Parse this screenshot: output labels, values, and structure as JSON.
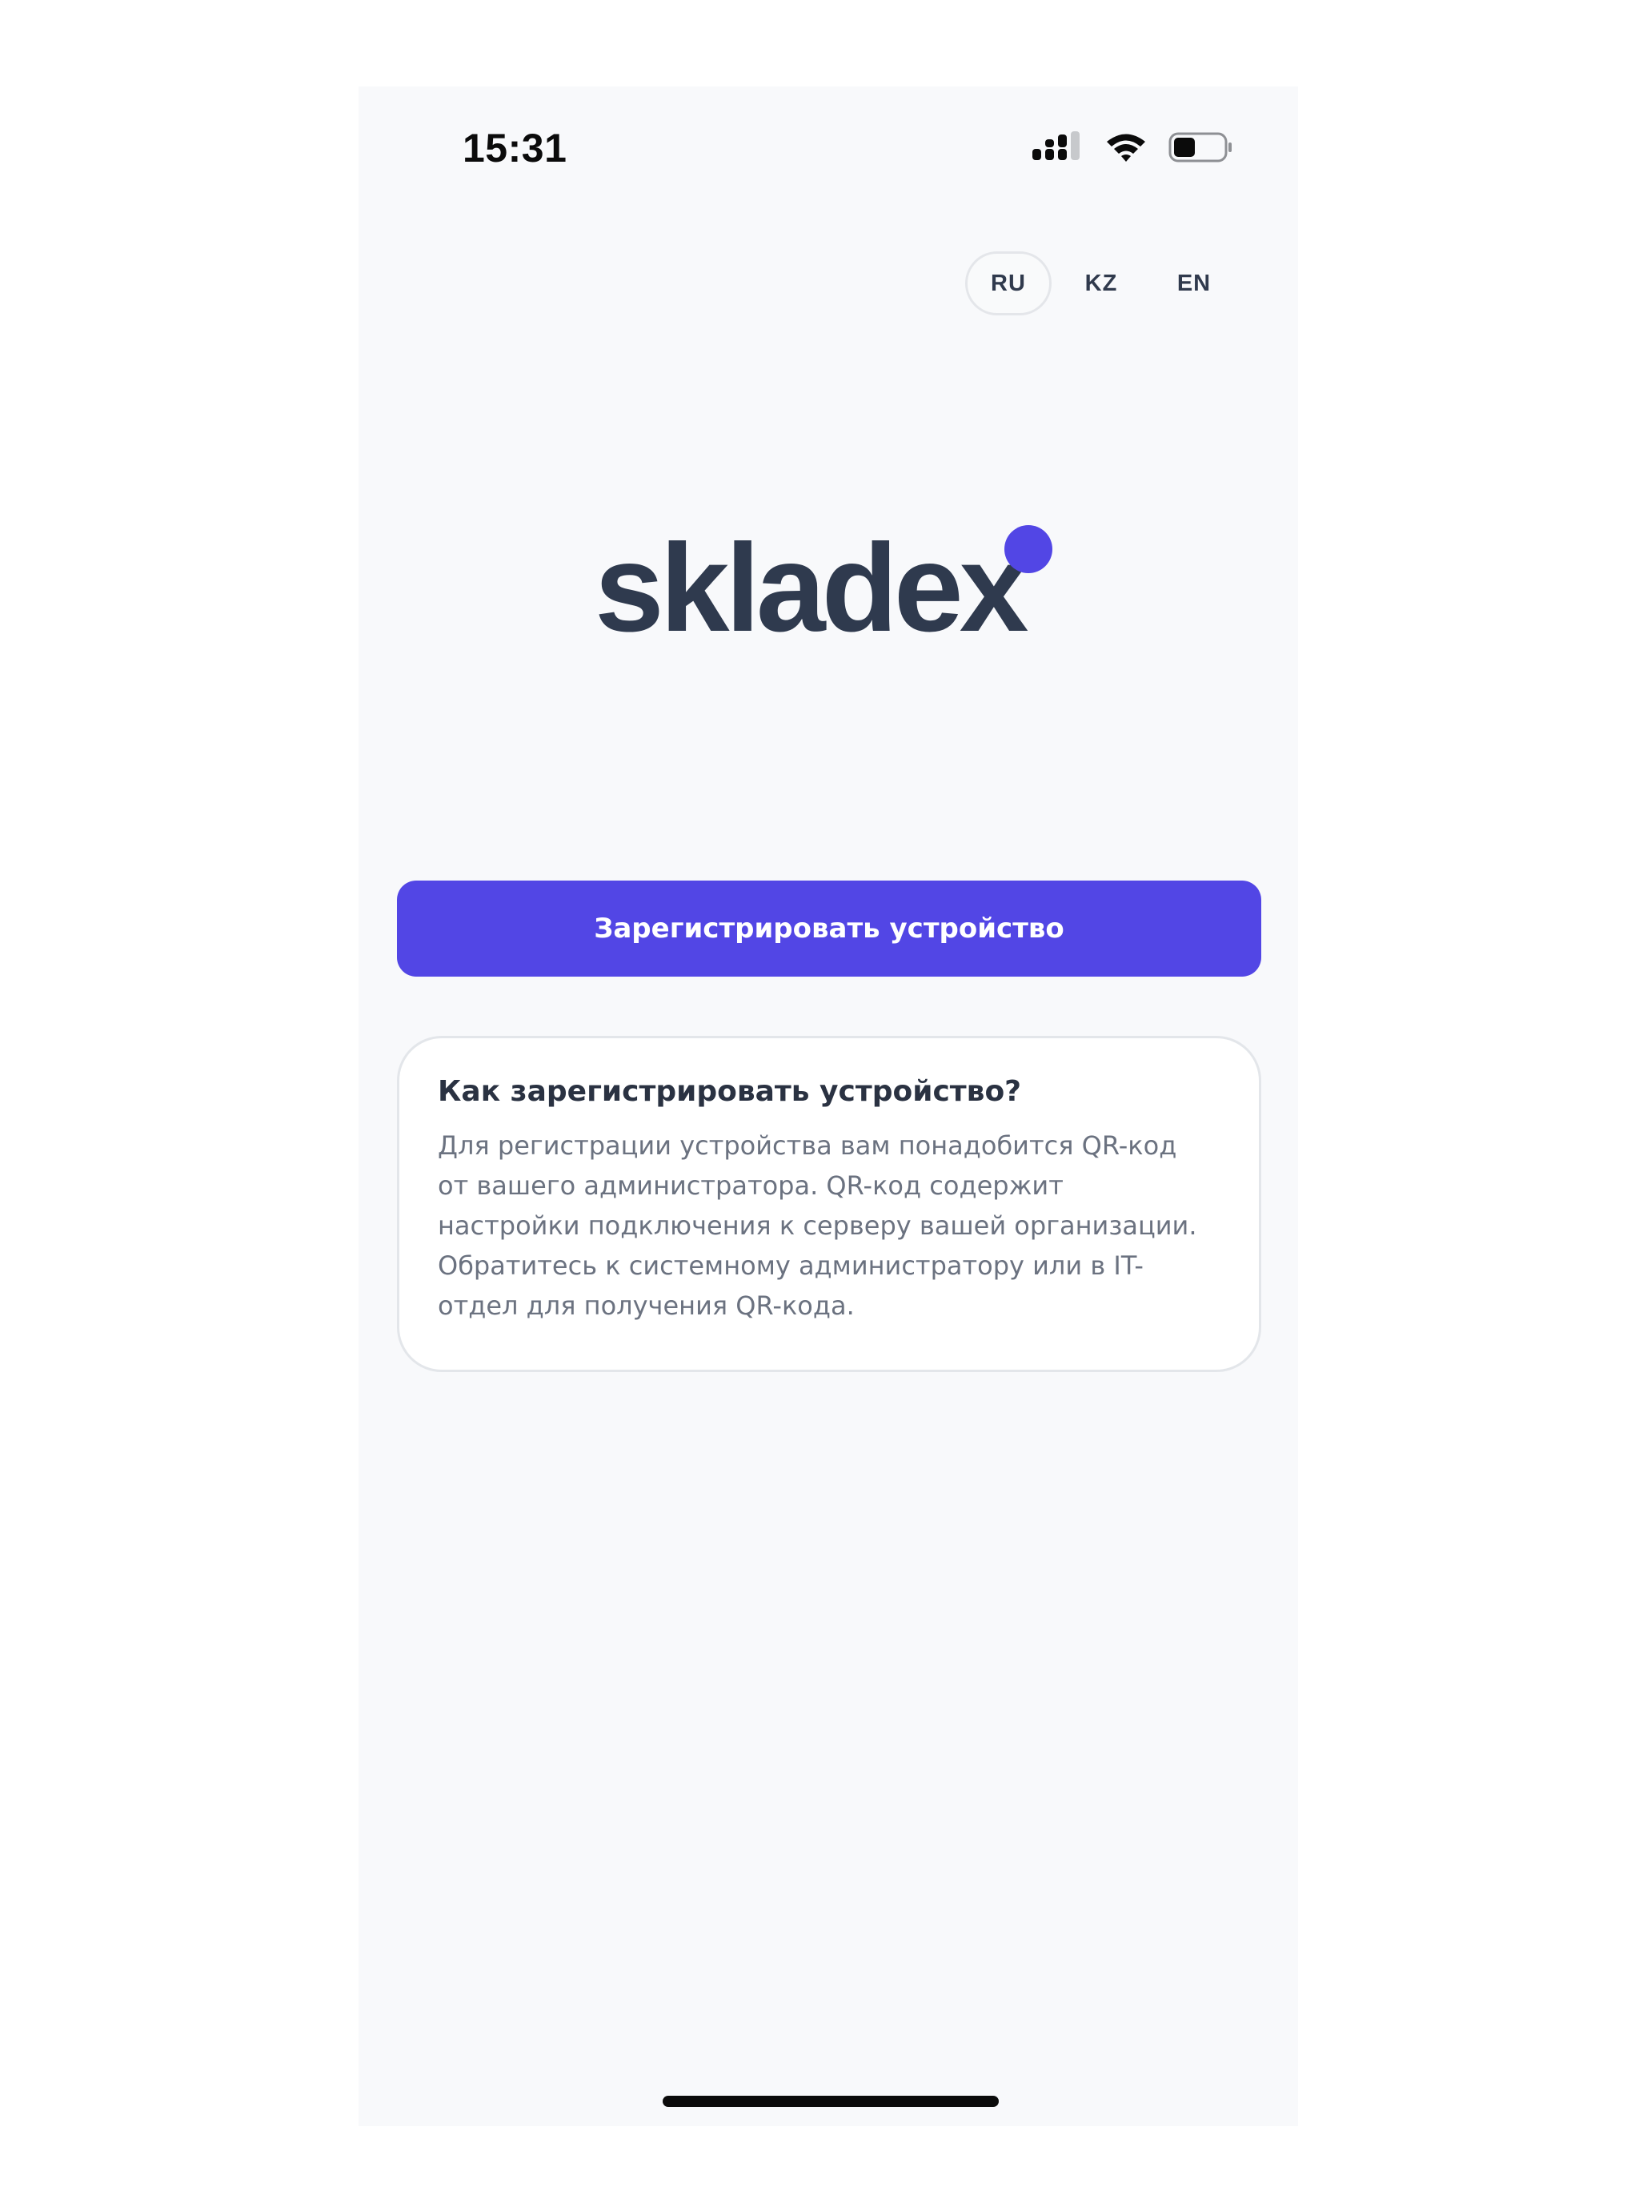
{
  "status_bar": {
    "time": "15:31",
    "icons": [
      "cellular-signal-icon",
      "wifi-icon",
      "battery-icon"
    ]
  },
  "languages": [
    {
      "code": "RU",
      "active": true
    },
    {
      "code": "KZ",
      "active": false
    },
    {
      "code": "EN",
      "active": false
    }
  ],
  "logo": {
    "text": "skladex",
    "dot_color": "#5246e5",
    "text_color": "#2f3a4e"
  },
  "actions": {
    "register_label": "Зарегистрировать устройство"
  },
  "info": {
    "title": "Как зарегистрировать устройство?",
    "lines": [
      "Для регистрации устройства вам понадобится QR-код",
      "от вашего администратора. QR-код содержит",
      "настройки подключения к серверу вашей организации.",
      "Обратитесь к системному администратору или в IT-",
      "отдел для получения QR-кода."
    ]
  },
  "colors": {
    "accent": "#5246e5",
    "background": "#f8f9fb",
    "card_border": "#e3e6ea"
  }
}
